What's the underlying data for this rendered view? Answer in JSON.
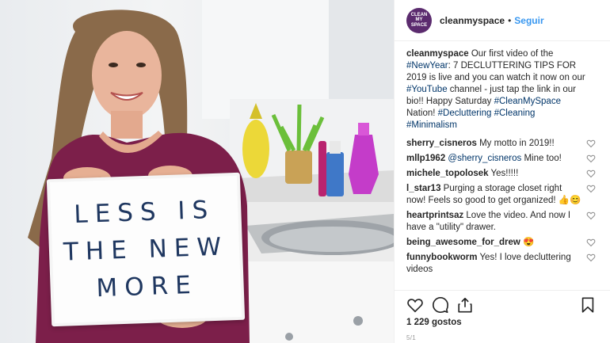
{
  "header": {
    "avatar_lines": [
      "CLEAN",
      "MY",
      "SPACE"
    ],
    "username": "cleanmyspace",
    "separator": "•",
    "follow_label": "Seguir"
  },
  "photo": {
    "sign_lines": [
      "LESS IS",
      "THE NEW",
      "MORE"
    ]
  },
  "caption": {
    "username": "cleanmyspace",
    "t1": " Our first video of the ",
    "tag1": "#NewYear",
    "t2": ": 7 DECLUTTERING TIPS FOR 2019 is live and you can watch it now on our ",
    "tag2": "#YouTube",
    "t3": " channel - just tap the link in our bio!! Happy Saturday ",
    "tag3": "#CleanMySpace",
    "t4": " Nation! ",
    "tag4": "#Decluttering",
    "t5": " ",
    "tag5": "#Cleaning",
    "t6": " ",
    "tag6": "#Minimalism"
  },
  "comments": [
    {
      "user": "sherry_cisneros",
      "text": " My motto in 2019!!"
    },
    {
      "user": "mllp1962",
      "mention": " @sherry_cisneros",
      "text": " Mine too!"
    },
    {
      "user": "michele_topolosek",
      "text": " Yes!!!!!"
    },
    {
      "user": "l_star13",
      "text": " Purging a storage closet right now! Feels so good to get organized! 👍😊"
    },
    {
      "user": "heartprintsaz",
      "text": " Love the video. And now I have a \"utility\" drawer."
    },
    {
      "user": "being_awesome_for_drew",
      "text": " 😍"
    },
    {
      "user": "funnybookworm",
      "text": " Yes! I love decluttering videos"
    }
  ],
  "icons": {
    "like": "heart-outline-icon",
    "comment": "comment-bubble-icon",
    "share": "share-upload-icon",
    "save": "bookmark-icon"
  },
  "likes_text": "1 229 gostos",
  "date_text": "5/1",
  "colors": {
    "follow": "#3897f0",
    "hashtag": "#003569",
    "brand_avatar": "#5b2b6e",
    "divider": "#efefef"
  }
}
